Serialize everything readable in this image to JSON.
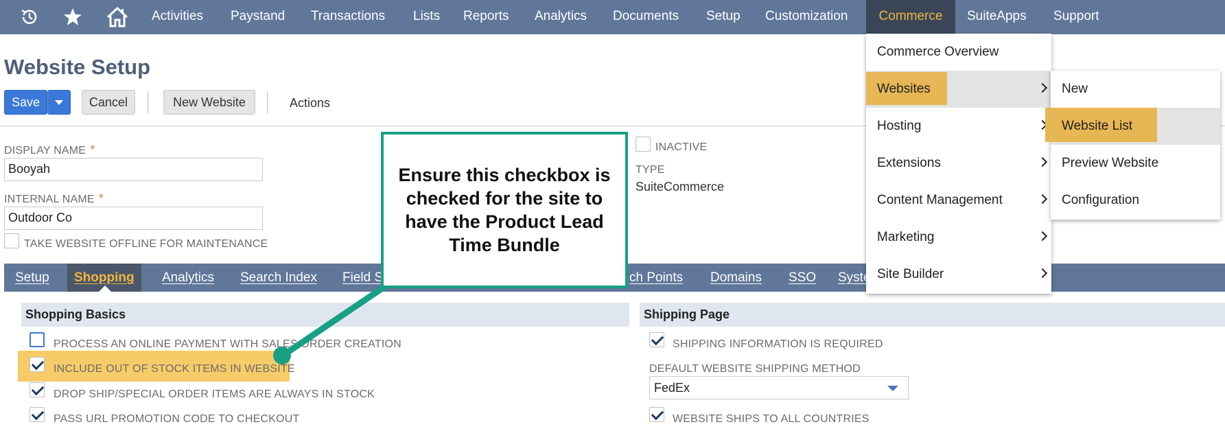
{
  "nav": {
    "items": [
      {
        "label": "Activities"
      },
      {
        "label": "Paystand"
      },
      {
        "label": "Transactions"
      },
      {
        "label": "Lists"
      },
      {
        "label": "Reports"
      },
      {
        "label": "Analytics"
      },
      {
        "label": "Documents"
      },
      {
        "label": "Setup"
      },
      {
        "label": "Customization"
      },
      {
        "label": "Commerce"
      },
      {
        "label": "SuiteApps"
      },
      {
        "label": "Support"
      }
    ],
    "active": "Commerce",
    "icons": [
      "recent-records-icon",
      "star-icon",
      "home-icon"
    ]
  },
  "page": {
    "title": "Website Setup"
  },
  "toolbar": {
    "save_label": "Save",
    "cancel_label": "Cancel",
    "new_website_label": "New Website",
    "actions_label": "Actions"
  },
  "form": {
    "display_name_label": "DISPLAY NAME",
    "display_name_value": "Booyah",
    "internal_name_label": "INTERNAL NAME",
    "internal_name_value": "Outdoor Co",
    "required_marker": "*",
    "offline_label": "TAKE WEBSITE OFFLINE FOR MAINTENANCE",
    "offline_checked": false,
    "inactive_label": "INACTIVE",
    "inactive_checked": false,
    "type_label": "TYPE",
    "type_value": "SuiteCommerce"
  },
  "tabs": [
    {
      "label": "Setup"
    },
    {
      "label": "Shopping",
      "active": true
    },
    {
      "label": "Analytics"
    },
    {
      "label": "Search Index"
    },
    {
      "label": "Field Se"
    },
    {
      "label": "ch Points"
    },
    {
      "label": "Domains"
    },
    {
      "label": "SSO"
    },
    {
      "label": "Syste"
    }
  ],
  "shopping_basics": {
    "title": "Shopping Basics",
    "items": [
      {
        "label": "PROCESS AN ONLINE PAYMENT WITH SALES ORDER CREATION",
        "checked": false
      },
      {
        "label": "INCLUDE OUT OF STOCK ITEMS IN WEBSITE",
        "checked": true
      },
      {
        "label": "DROP SHIP/SPECIAL ORDER ITEMS ARE ALWAYS IN STOCK",
        "checked": true
      },
      {
        "label": "PASS URL PROMOTION CODE TO CHECKOUT",
        "checked": true
      }
    ]
  },
  "shipping_page": {
    "title": "Shipping Page",
    "shipping_required_label": "SHIPPING INFORMATION IS REQUIRED",
    "shipping_required_checked": true,
    "default_method_label": "DEFAULT WEBSITE SHIPPING METHOD",
    "default_method_value": "FedEx",
    "ships_all_label": "WEBSITE SHIPS TO ALL COUNTRIES",
    "ships_all_checked": true
  },
  "commerce_menu": {
    "items": [
      {
        "label": "Commerce Overview",
        "has_submenu": false
      },
      {
        "label": "Websites",
        "has_submenu": true
      },
      {
        "label": "Hosting",
        "has_submenu": true
      },
      {
        "label": "Extensions",
        "has_submenu": true
      },
      {
        "label": "Content Management",
        "has_submenu": true
      },
      {
        "label": "Marketing",
        "has_submenu": true
      },
      {
        "label": "Site Builder",
        "has_submenu": true
      }
    ]
  },
  "websites_submenu": {
    "items": [
      {
        "label": "New"
      },
      {
        "label": "Website List"
      },
      {
        "label": "Preview Website"
      },
      {
        "label": "Configuration"
      }
    ]
  },
  "callout": {
    "text": "Ensure this checkbox is checked for the site to have the Product Lead Time Bundle"
  },
  "colors": {
    "nav_bg": "#607799",
    "accent_gold": "#f2b63d",
    "highlight": "#f6c34e",
    "callout_border": "#17a084",
    "save_blue": "#3b79d8"
  }
}
